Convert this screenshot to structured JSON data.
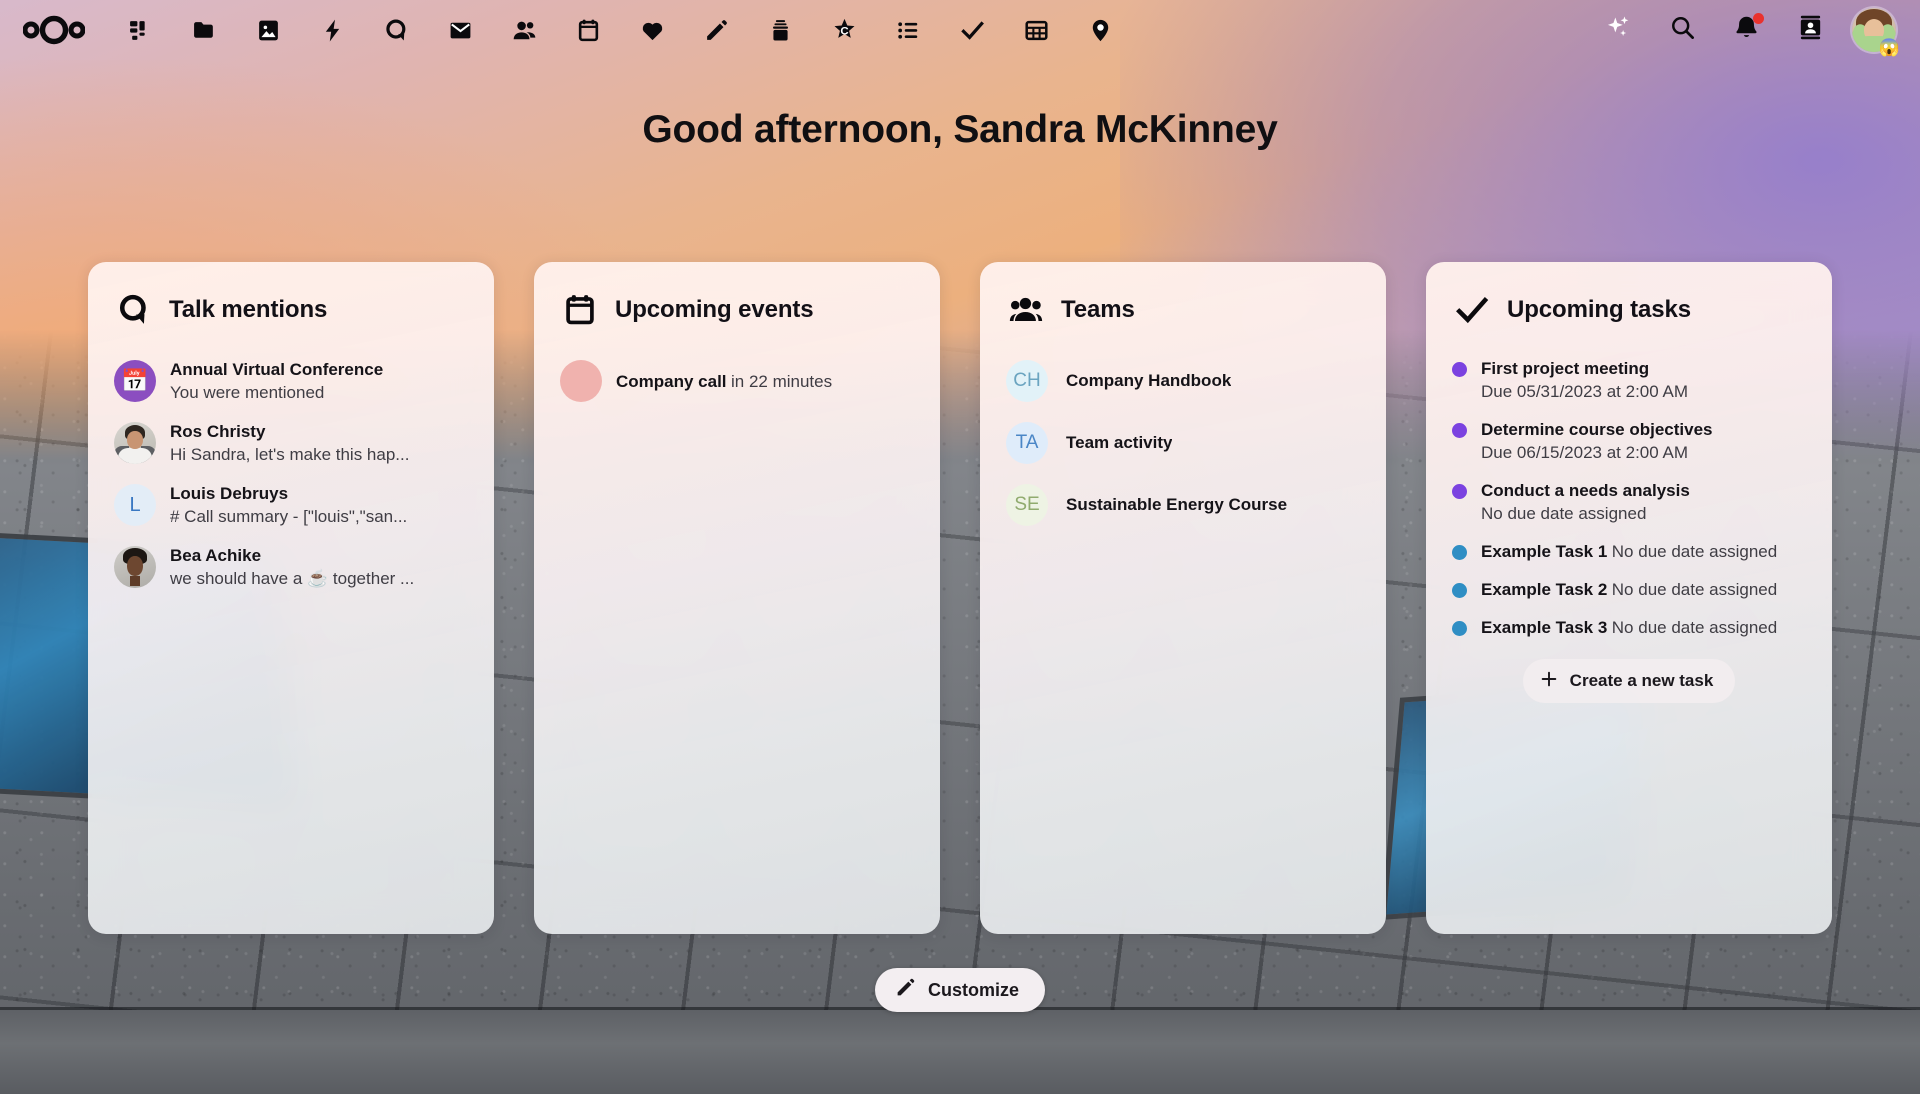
{
  "app": {
    "name": "Nextcloud",
    "logo_icon": "nextcloud-logo-icon"
  },
  "topbar": {
    "apps": [
      {
        "name": "Dashboard",
        "icon": "dashboard-icon"
      },
      {
        "name": "Files",
        "icon": "folder-icon"
      },
      {
        "name": "Photos",
        "icon": "image-icon"
      },
      {
        "name": "Activity",
        "icon": "lightning-bolt-icon"
      },
      {
        "name": "Talk",
        "icon": "talk-bubble-icon"
      },
      {
        "name": "Mail",
        "icon": "envelope-icon"
      },
      {
        "name": "Contacts",
        "icon": "people-icon"
      },
      {
        "name": "Calendar",
        "icon": "calendar-icon"
      },
      {
        "name": "Health",
        "icon": "heart-icon"
      },
      {
        "name": "Notes",
        "icon": "pencil-icon"
      },
      {
        "name": "Deck",
        "icon": "deck-stack-icon"
      },
      {
        "name": "Collectives",
        "icon": "collectives-star-icon"
      },
      {
        "name": "Tasks",
        "icon": "list-icon"
      },
      {
        "name": "Checks",
        "icon": "check-icon"
      },
      {
        "name": "Tables",
        "icon": "table-grid-icon"
      },
      {
        "name": "Maps",
        "icon": "map-pin-icon"
      }
    ],
    "controls": [
      {
        "name": "Assistant",
        "icon": "sparkles-icon",
        "badge": false
      },
      {
        "name": "Search",
        "icon": "magnifier-icon",
        "badge": false
      },
      {
        "name": "Notifications",
        "icon": "bell-icon",
        "badge": true
      },
      {
        "name": "Contacts menu",
        "icon": "contact-card-icon",
        "badge": false
      }
    ],
    "avatar": {
      "name": "Sandra McKinney",
      "status_emoji": "😱"
    }
  },
  "greeting": "Good afternoon, Sandra McKinney",
  "widgets": [
    {
      "id": "talk-mentions",
      "title": "Talk mentions",
      "icon": "talk-bubble-icon",
      "items": [
        {
          "title": "Annual Virtual Conference",
          "subtitle": "You were mentioned",
          "avatar_kind": "calendar",
          "avatar_text": "📅"
        },
        {
          "title": "Ros Christy",
          "subtitle": "Hi Sandra, let's make this hap...",
          "avatar_kind": "photo-man",
          "avatar_text": ""
        },
        {
          "title": "Louis Debruys",
          "subtitle": "# Call summary - [\"louis\",\"san...",
          "avatar_kind": "letter",
          "avatar_text": "L"
        },
        {
          "title": "Bea Achike",
          "subtitle": "we should have a ☕ together ...",
          "avatar_kind": "photo-woman",
          "avatar_text": ""
        }
      ]
    },
    {
      "id": "upcoming-events",
      "title": "Upcoming events",
      "icon": "calendar-icon",
      "items": [
        {
          "title": "Company call",
          "subtitle": "in 22 minutes",
          "dot_color": "#f0b2ae"
        }
      ]
    },
    {
      "id": "teams",
      "title": "Teams",
      "icon": "people-icon",
      "items": [
        {
          "label": "Company Handbook",
          "initials": "CH",
          "bg": "#e2f2f8",
          "fg": "#6ba4c0"
        },
        {
          "label": "Team activity",
          "initials": "TA",
          "bg": "#dfecfa",
          "fg": "#4a86c6"
        },
        {
          "label": "Sustainable Energy Course",
          "initials": "SE",
          "bg": "#eef3e4",
          "fg": "#90ab6e"
        }
      ]
    },
    {
      "id": "upcoming-tasks",
      "title": "Upcoming tasks",
      "icon": "check-icon",
      "items": [
        {
          "title": "First project meeting",
          "subtitle": "Due 05/31/2023 at 2:00 AM",
          "color": "#7b42e0"
        },
        {
          "title": "Determine course objectives",
          "subtitle": "Due 06/15/2023 at 2:00 AM",
          "color": "#7b42e0"
        },
        {
          "title": "Conduct a needs analysis",
          "subtitle": "No due date assigned",
          "color": "#7b42e0"
        },
        {
          "title": "Example Task 1",
          "subtitle": "No due date assigned",
          "color": "#2f8ec4"
        },
        {
          "title": "Example Task 2",
          "subtitle": "No due date assigned",
          "color": "#2f8ec4"
        },
        {
          "title": "Example Task 3",
          "subtitle": "No due date assigned",
          "color": "#2f8ec4"
        }
      ],
      "create_button": {
        "label": "Create a new task",
        "icon": "plus-icon"
      }
    }
  ],
  "customize_button": {
    "label": "Customize",
    "icon": "pencil-icon"
  },
  "colors": {
    "text_primary": "#151318",
    "text_secondary": "#3f3d44",
    "task_purple": "#7b42e0",
    "task_blue": "#2f8ec4",
    "notification_badge": "#e9322e",
    "event_dot": "#f0b2ae",
    "button_surface": "#f3eef1"
  }
}
